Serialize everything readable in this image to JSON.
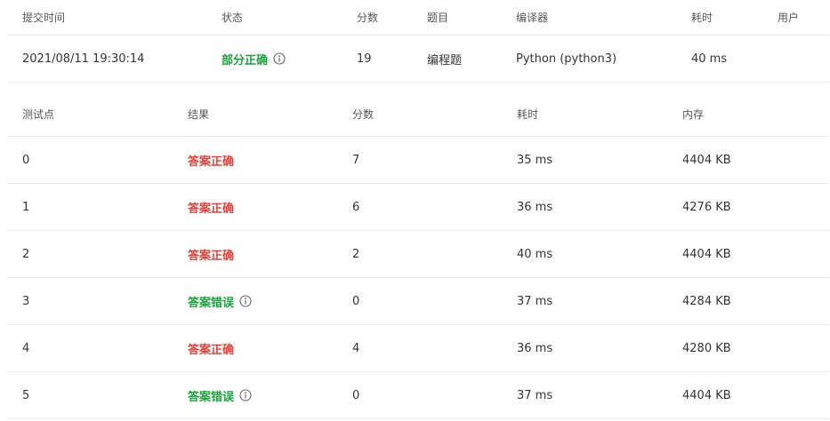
{
  "summary": {
    "headers": {
      "time": "提交时间",
      "status": "状态",
      "score": "分数",
      "type": "题目",
      "compiler": "编译器",
      "cost": "耗时",
      "user": "用户"
    },
    "row": {
      "time": "2021/08/11 19:30:14",
      "status": "部分正确",
      "score": "19",
      "type": "编程题",
      "compiler": "Python (python3)",
      "cost": "40 ms",
      "user": ""
    }
  },
  "cases": {
    "headers": {
      "id": "测试点",
      "result": "结果",
      "score": "分数",
      "cost": "耗时",
      "mem": "内存"
    },
    "rows": [
      {
        "id": "0",
        "result": "答案正确",
        "kind": "ok",
        "score": "7",
        "cost": "35 ms",
        "mem": "4404 KB"
      },
      {
        "id": "1",
        "result": "答案正确",
        "kind": "ok",
        "score": "6",
        "cost": "36 ms",
        "mem": "4276 KB"
      },
      {
        "id": "2",
        "result": "答案正确",
        "kind": "ok",
        "score": "2",
        "cost": "40 ms",
        "mem": "4404 KB"
      },
      {
        "id": "3",
        "result": "答案错误",
        "kind": "err",
        "score": "0",
        "cost": "37 ms",
        "mem": "4284 KB"
      },
      {
        "id": "4",
        "result": "答案正确",
        "kind": "ok",
        "score": "4",
        "cost": "36 ms",
        "mem": "4280 KB"
      },
      {
        "id": "5",
        "result": "答案错误",
        "kind": "err",
        "score": "0",
        "cost": "37 ms",
        "mem": "4404 KB"
      }
    ]
  },
  "colors": {
    "correct_red": "#e2413a",
    "wrong_green": "#19a33a",
    "partial_green": "#19a33a",
    "divider": "#e8e8e8"
  },
  "icons": {
    "info": "info-circle-icon"
  }
}
